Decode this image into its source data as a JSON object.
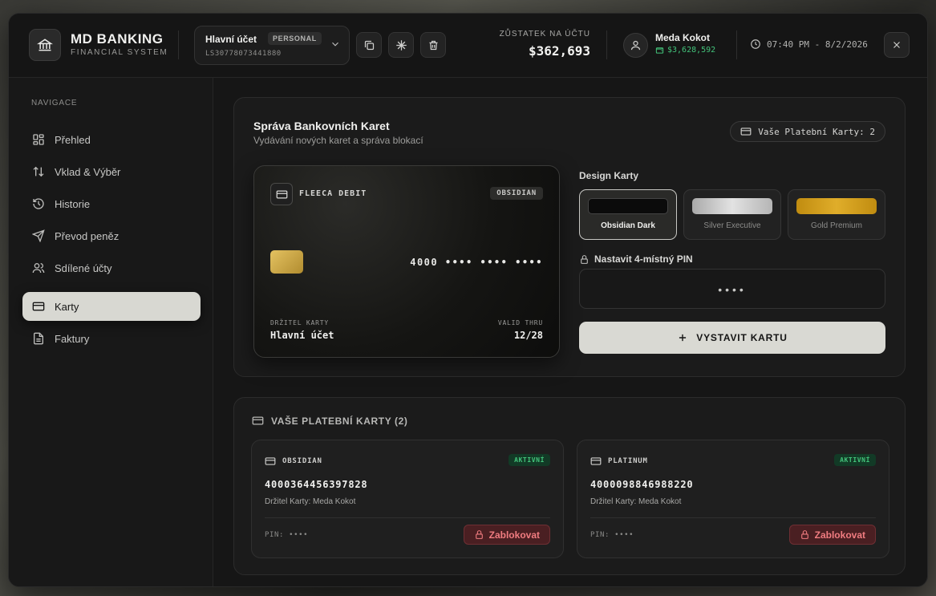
{
  "brand": {
    "title": "MD BANKING",
    "subtitle": "FINANCIAL SYSTEM"
  },
  "account": {
    "name": "Hlavní účet",
    "badge": "PERSONAL",
    "number": "LS30778073441880"
  },
  "balance": {
    "label": "ZŮSTATEK NA ÚČTU",
    "value": "$362,693"
  },
  "user": {
    "name": "Meda Kokot",
    "cash": "$3,628,592"
  },
  "clock": "07:40 PM - 8/2/2026",
  "sidebar": {
    "label": "NAVIGACE",
    "items": [
      {
        "label": "Přehled",
        "icon": "grid-icon"
      },
      {
        "label": "Vklad & Výběr",
        "icon": "arrows-icon"
      },
      {
        "label": "Historie",
        "icon": "history-icon"
      },
      {
        "label": "Převod peněz",
        "icon": "send-icon"
      },
      {
        "label": "Sdílené účty",
        "icon": "users-icon"
      },
      {
        "label": "Karty",
        "icon": "card-icon",
        "active": true
      },
      {
        "label": "Faktury",
        "icon": "document-icon"
      }
    ]
  },
  "issue": {
    "title": "Správa Bankovních Karet",
    "subtitle": "Vydávání nových karet a správa blokací",
    "count_label": "Vaše Platební Karty: 2",
    "preview": {
      "brand": "FLEECA DEBIT",
      "tier": "OBSIDIAN",
      "number": "4000 •••• •••• ••••",
      "holder_label": "DRŽITEL KARTY",
      "holder": "Hlavní účet",
      "valid_label": "VALID THRU",
      "valid": "12/28"
    },
    "design_label": "Design Karty",
    "designs": [
      {
        "name": "Obsidian Dark",
        "color": "#0e0e0e",
        "selected": true
      },
      {
        "name": "Silver Executive",
        "color": "#c9c9c9"
      },
      {
        "name": "Gold Premium",
        "color": "#d4a017"
      }
    ],
    "pin_label": "Nastavit 4-místný PIN",
    "pin_value": "••••",
    "button_label": "VYSTAVIT KARTU"
  },
  "cards": {
    "title": "VAŠE PLATEBNÍ KARTY (2)",
    "items": [
      {
        "type": "OBSIDIAN",
        "status": "AKTIVNÍ",
        "number": "4000364456397828",
        "holder": "Držitel Karty: Meda Kokot",
        "pin": "PIN: ••••",
        "block_label": "Zablokovat"
      },
      {
        "type": "PLATINUM",
        "status": "AKTIVNÍ",
        "number": "4000098846988220",
        "holder": "Držitel Karty: Meda Kokot",
        "pin": "PIN: ••••",
        "block_label": "Zablokovat"
      }
    ]
  },
  "colors": {
    "accent": "#d9d9d3",
    "positive": "#43c47b",
    "danger": "#f07c80"
  }
}
